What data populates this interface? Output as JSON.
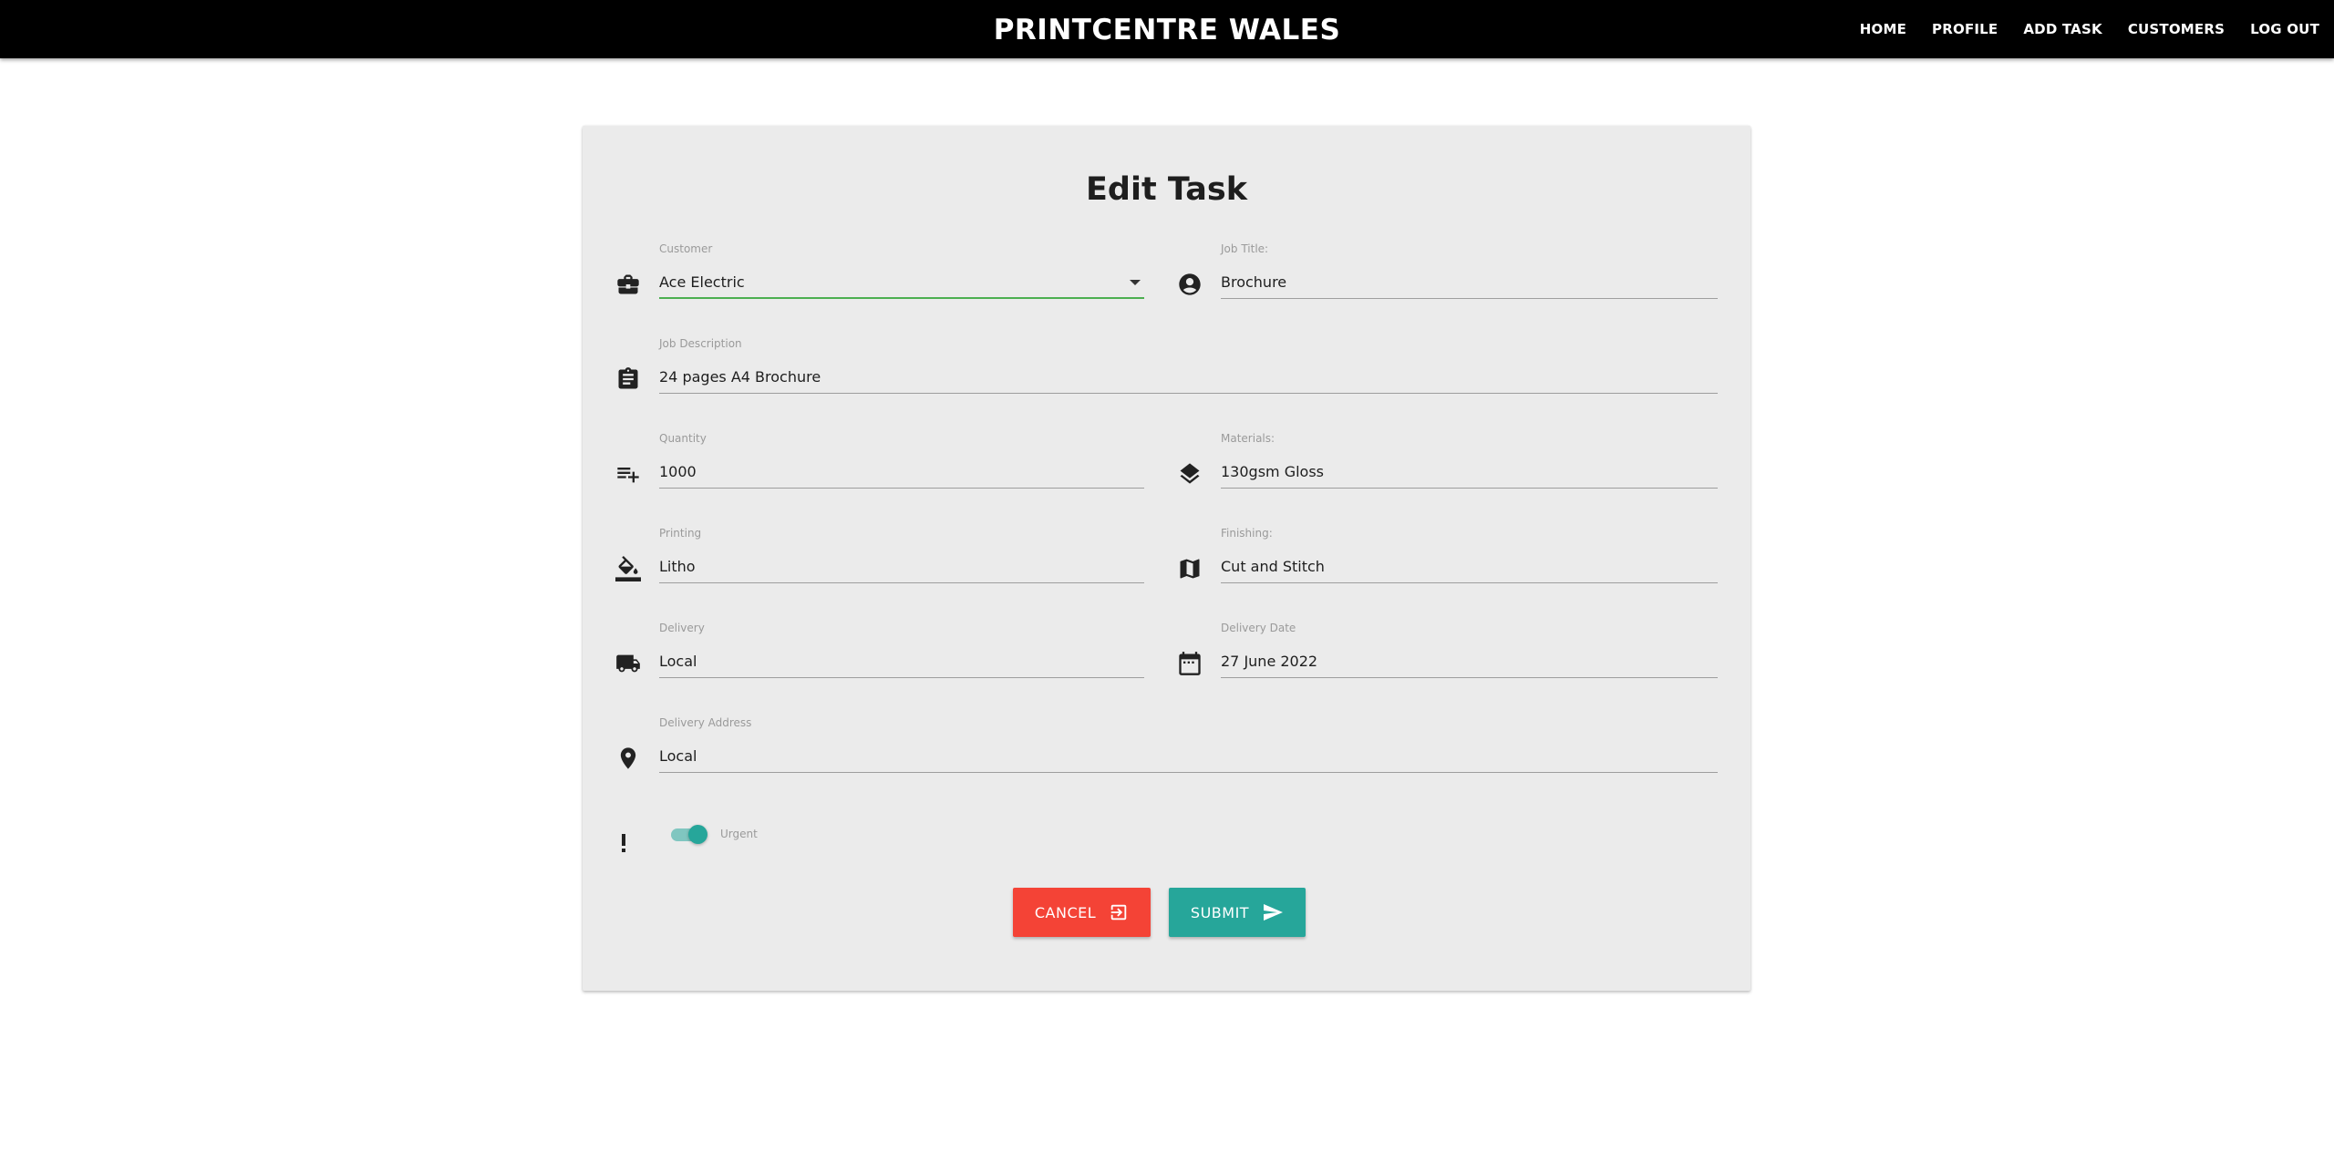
{
  "nav": {
    "brand": "PRINTCENTRE WALES",
    "links": [
      "HOME",
      "PROFILE",
      "ADD TASK",
      "CUSTOMERS",
      "LOG OUT"
    ]
  },
  "form": {
    "title": "Edit Task",
    "customer": {
      "label": "Customer",
      "value": "Ace Electric",
      "icon": "briefcase-icon"
    },
    "job_title": {
      "label": "Job Title:",
      "value": "Brochure",
      "icon": "account-circle-icon"
    },
    "job_description": {
      "label": "Job Description",
      "value": "24 pages A4 Brochure",
      "icon": "clipboard-icon"
    },
    "quantity": {
      "label": "Quantity",
      "value": "1000",
      "icon": "playlist-add-icon"
    },
    "materials": {
      "label": "Materials:",
      "value": "130gsm Gloss",
      "icon": "layers-icon"
    },
    "printing": {
      "label": "Printing",
      "value": "Litho",
      "icon": "format-color-fill-icon"
    },
    "finishing": {
      "label": "Finishing:",
      "value": "Cut and Stitch",
      "icon": "map-icon"
    },
    "delivery": {
      "label": "Delivery",
      "value": "Local",
      "icon": "truck-icon"
    },
    "delivery_date": {
      "label": "Delivery Date",
      "value": "27 June 2022",
      "icon": "calendar-icon"
    },
    "delivery_address": {
      "label": "Delivery Address",
      "value": "Local",
      "icon": "location-pin-icon"
    },
    "urgent": {
      "label": "Urgent",
      "checked": true,
      "icon": "priority-high-icon"
    },
    "cancel_label": "CANCEL",
    "submit_label": "SUBMIT"
  },
  "colors": {
    "navbar": "#000000",
    "card": "#ebebeb",
    "active_underline": "#4caf50",
    "cancel": "#f44336",
    "submit": "#26a69a",
    "switch_track": "#80c6c0",
    "switch_knob": "#26a69a"
  }
}
